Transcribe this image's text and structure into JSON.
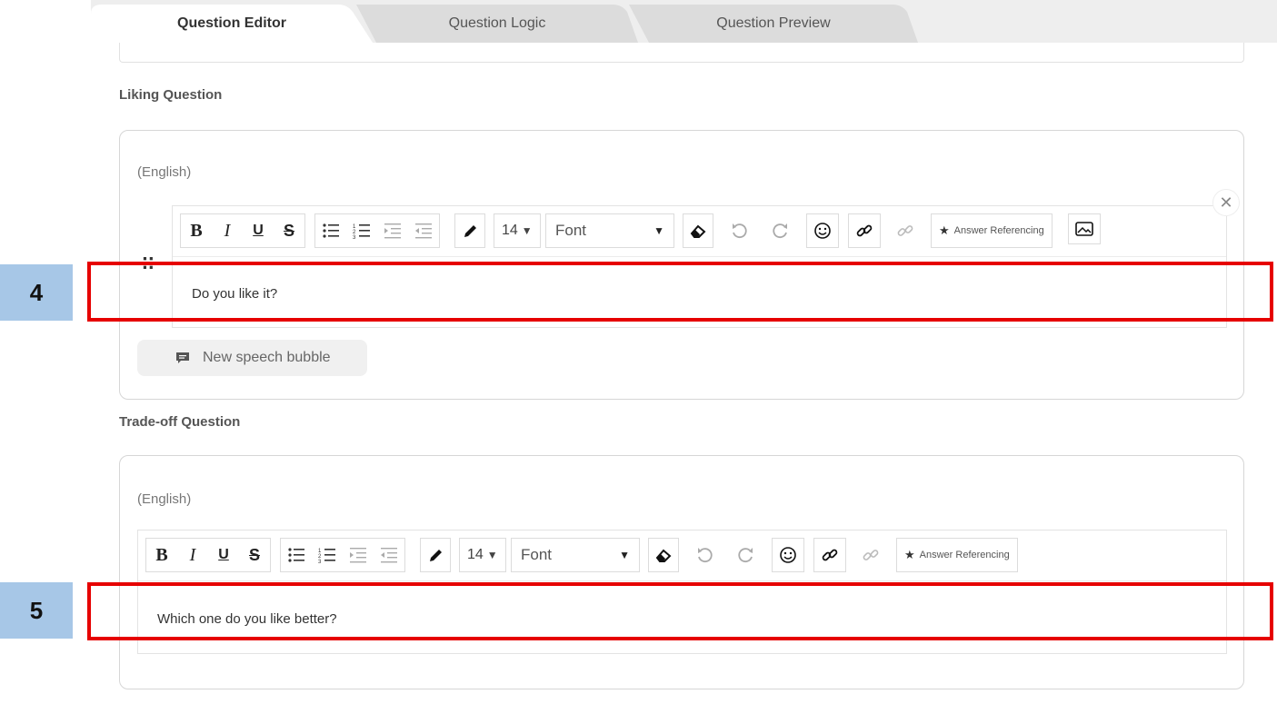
{
  "tabs": [
    {
      "label": "Question Editor",
      "active": true
    },
    {
      "label": "Question Logic",
      "active": false
    },
    {
      "label": "Question Preview",
      "active": false
    }
  ],
  "sections": [
    {
      "label": "Liking Question",
      "language": "(English)",
      "toolbar": {
        "size": "14",
        "font": "Font",
        "answer_referencing": "Answer Referencing"
      },
      "text": "Do you like it?",
      "new_bubble_label": "New speech bubble",
      "step": "4"
    },
    {
      "label": "Trade-off Question",
      "language": "(English)",
      "toolbar": {
        "size": "14",
        "font": "Font",
        "answer_referencing": "Answer Referencing"
      },
      "text": "Which one do you like better?",
      "step": "5"
    }
  ],
  "icons": {
    "close": "close-icon",
    "drag": "drag-handle-icon",
    "speech_bubble": "speech-bubble-icon"
  },
  "colors": {
    "highlight": "#e60000",
    "badge": "#a7c7e7"
  }
}
